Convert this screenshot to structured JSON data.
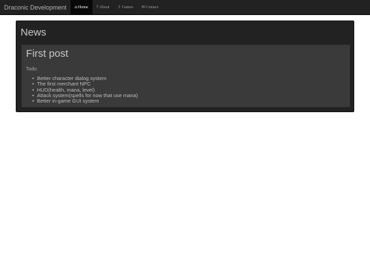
{
  "navbar": {
    "brand": "Draconic Development",
    "items": [
      {
        "label": "Home",
        "icon": "home-icon",
        "glyph": "⌂",
        "active": true
      },
      {
        "label": "About",
        "icon": "question-circle-icon",
        "glyph": "?",
        "active": false
      },
      {
        "label": "Games",
        "icon": "upload-arrow-icon",
        "glyph": "⇧",
        "active": false
      },
      {
        "label": "Contact",
        "icon": "envelope-icon",
        "glyph": "✉",
        "active": false
      }
    ]
  },
  "main": {
    "title": "News",
    "post": {
      "title": "First post",
      "intro": "Todo:",
      "items": [
        "Better character dialog system",
        "The first merchant NPC",
        "HUD(health, mana, level)",
        "Attack system(spells for now that use mana)",
        "Better in-game GUI system"
      ]
    }
  }
}
